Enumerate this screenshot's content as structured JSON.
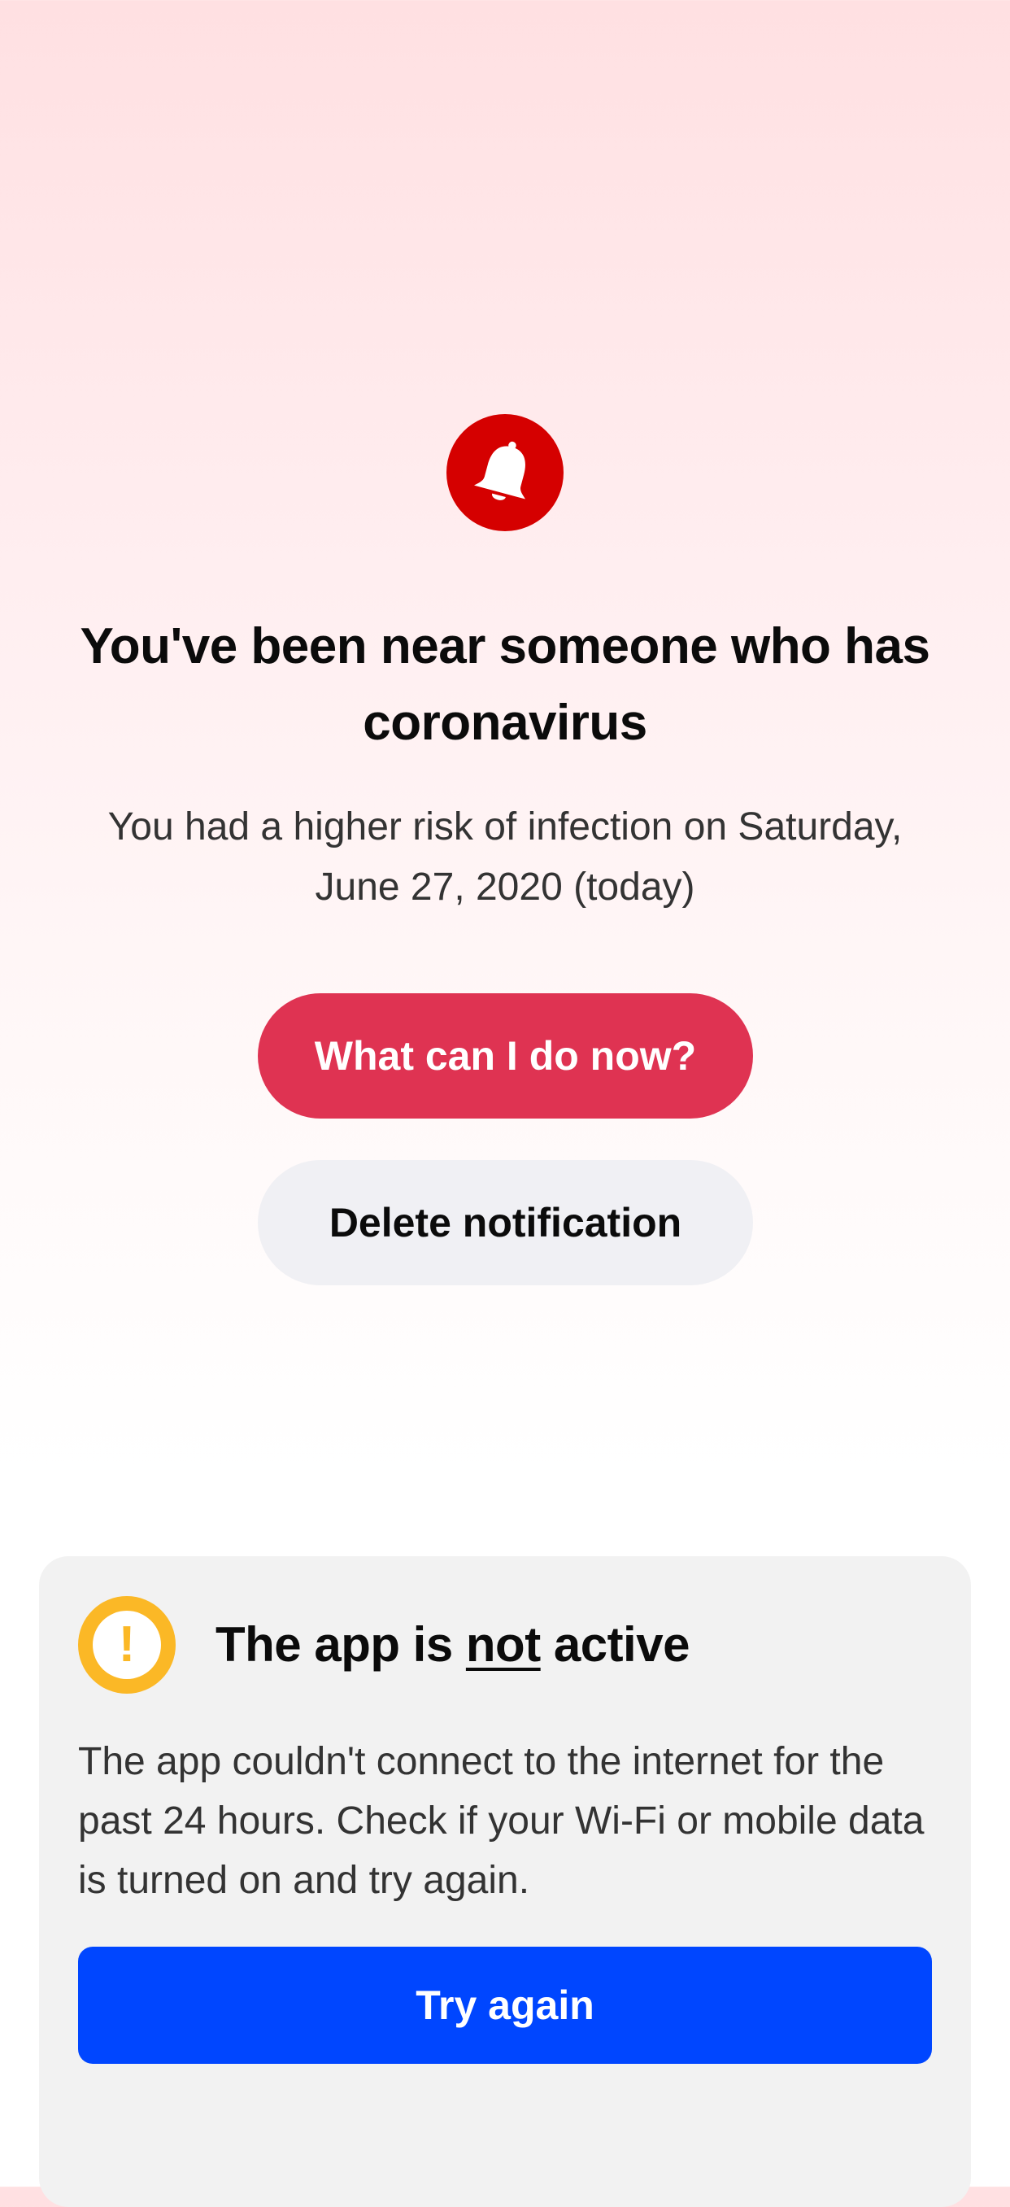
{
  "alert": {
    "icon": "bell-icon",
    "icon_color": "#d50000",
    "headline": "You've been near someone who has coronavirus",
    "subtext": "You had a higher risk of infection on Saturday, June 27, 2020 (today)"
  },
  "actions": {
    "primary_label": "What can I do now?",
    "primary_color": "#df3352",
    "secondary_label": "Delete notification"
  },
  "status_card": {
    "icon": "warning-icon",
    "icon_color": "#fbb826",
    "icon_glyph": "!",
    "title_prefix": "The app is ",
    "title_emphasis": "not",
    "title_suffix": " active",
    "body": "The app couldn't connect to the internet for the past 24 hours. Check if your Wi-Fi or mobile data is turned on and try again.",
    "button_label": "Try again",
    "button_color": "#0046ff"
  }
}
